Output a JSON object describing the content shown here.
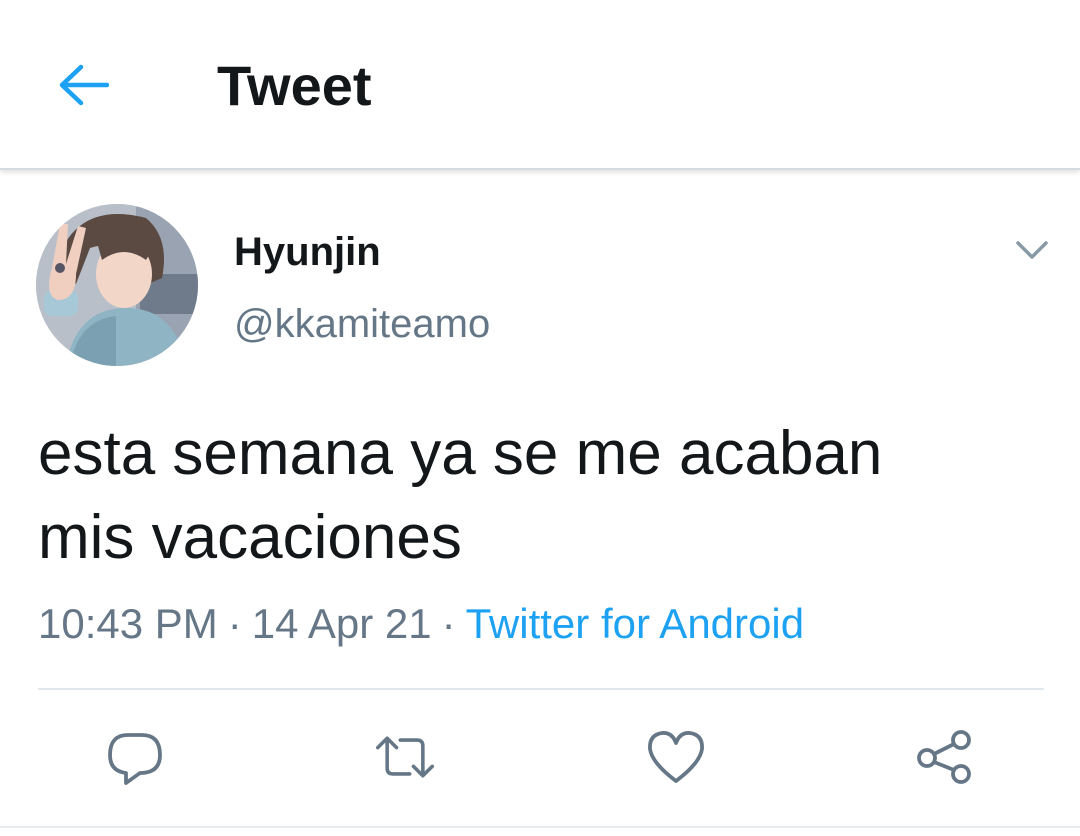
{
  "header": {
    "title": "Tweet",
    "back_icon": "arrow-left-icon",
    "accent_color": "#1da1f2"
  },
  "tweet": {
    "author_name": "Hyunjin",
    "author_handle": "@kkamiteamo",
    "text_line1": "esta semana ya se me acaban",
    "text_line2": "mis vacaciones",
    "time": "10:43 PM",
    "date": "14 Apr 21",
    "source": "Twitter for Android",
    "separator": "·"
  },
  "actions": [
    {
      "name": "reply",
      "icon": "comment-icon"
    },
    {
      "name": "retweet",
      "icon": "retweet-icon"
    },
    {
      "name": "like",
      "icon": "heart-icon"
    },
    {
      "name": "share",
      "icon": "share-icon"
    }
  ],
  "colors": {
    "text_primary": "#14171a",
    "text_secondary": "#657786",
    "link": "#1da1f2",
    "divider": "#e1e8ed"
  }
}
